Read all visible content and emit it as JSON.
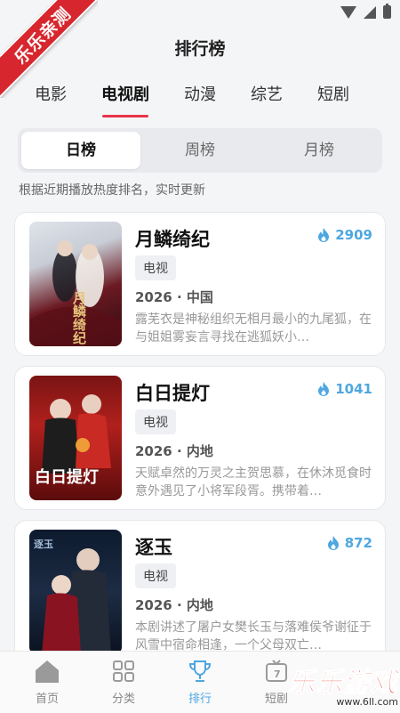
{
  "ribbon": "乐乐亲测",
  "page_title": "排行榜",
  "category_tabs": [
    {
      "label": "电影"
    },
    {
      "label": "电视剧"
    },
    {
      "label": "动漫"
    },
    {
      "label": "综艺"
    },
    {
      "label": "短剧"
    }
  ],
  "active_category": "电视剧",
  "rank_periods": [
    {
      "label": "日榜"
    },
    {
      "label": "周榜"
    },
    {
      "label": "月榜"
    }
  ],
  "active_period": "日榜",
  "hint": "根据近期播放热度排名，实时更新",
  "items": [
    {
      "title": "月鳞绮纪",
      "heat": "2909",
      "tag": "电视",
      "meta": "2026 · 中国",
      "desc": "露芜衣是神秘组织无相月最小的九尾狐，在与姐姐雾妄言寻找在逃狐妖小…",
      "poster_text": "月鳞绮纪"
    },
    {
      "title": "白日提灯",
      "heat": "1041",
      "tag": "电视",
      "meta": "2026 · 内地",
      "desc": "天赋卓然的万灵之主贺思慕，在休沐觅食时意外遇见了小将军段胥。携带着…",
      "poster_text": "白日提灯"
    },
    {
      "title": "逐玉",
      "heat": "872",
      "tag": "电视",
      "meta": "2026 · 内地",
      "desc": "本剧讲述了屠户女樊长玉与落难侯爷谢征于风雪中宿命相逢，一个父母双亡…",
      "poster_text": "逐玉"
    }
  ],
  "bottom_nav": [
    {
      "label": "首页",
      "icon": "home-icon"
    },
    {
      "label": "分类",
      "icon": "grid-icon"
    },
    {
      "label": "排行",
      "icon": "trophy-icon"
    },
    {
      "label": "短剧",
      "icon": "tv-icon"
    }
  ],
  "active_nav": "排行",
  "nav_badge": "7",
  "watermark": {
    "text": "乐乐游戏",
    "url": "www.6ll.com"
  },
  "colors": {
    "accent": "#4ea7e0",
    "underline": "#e8344a",
    "ribbon": "#d7262d"
  }
}
